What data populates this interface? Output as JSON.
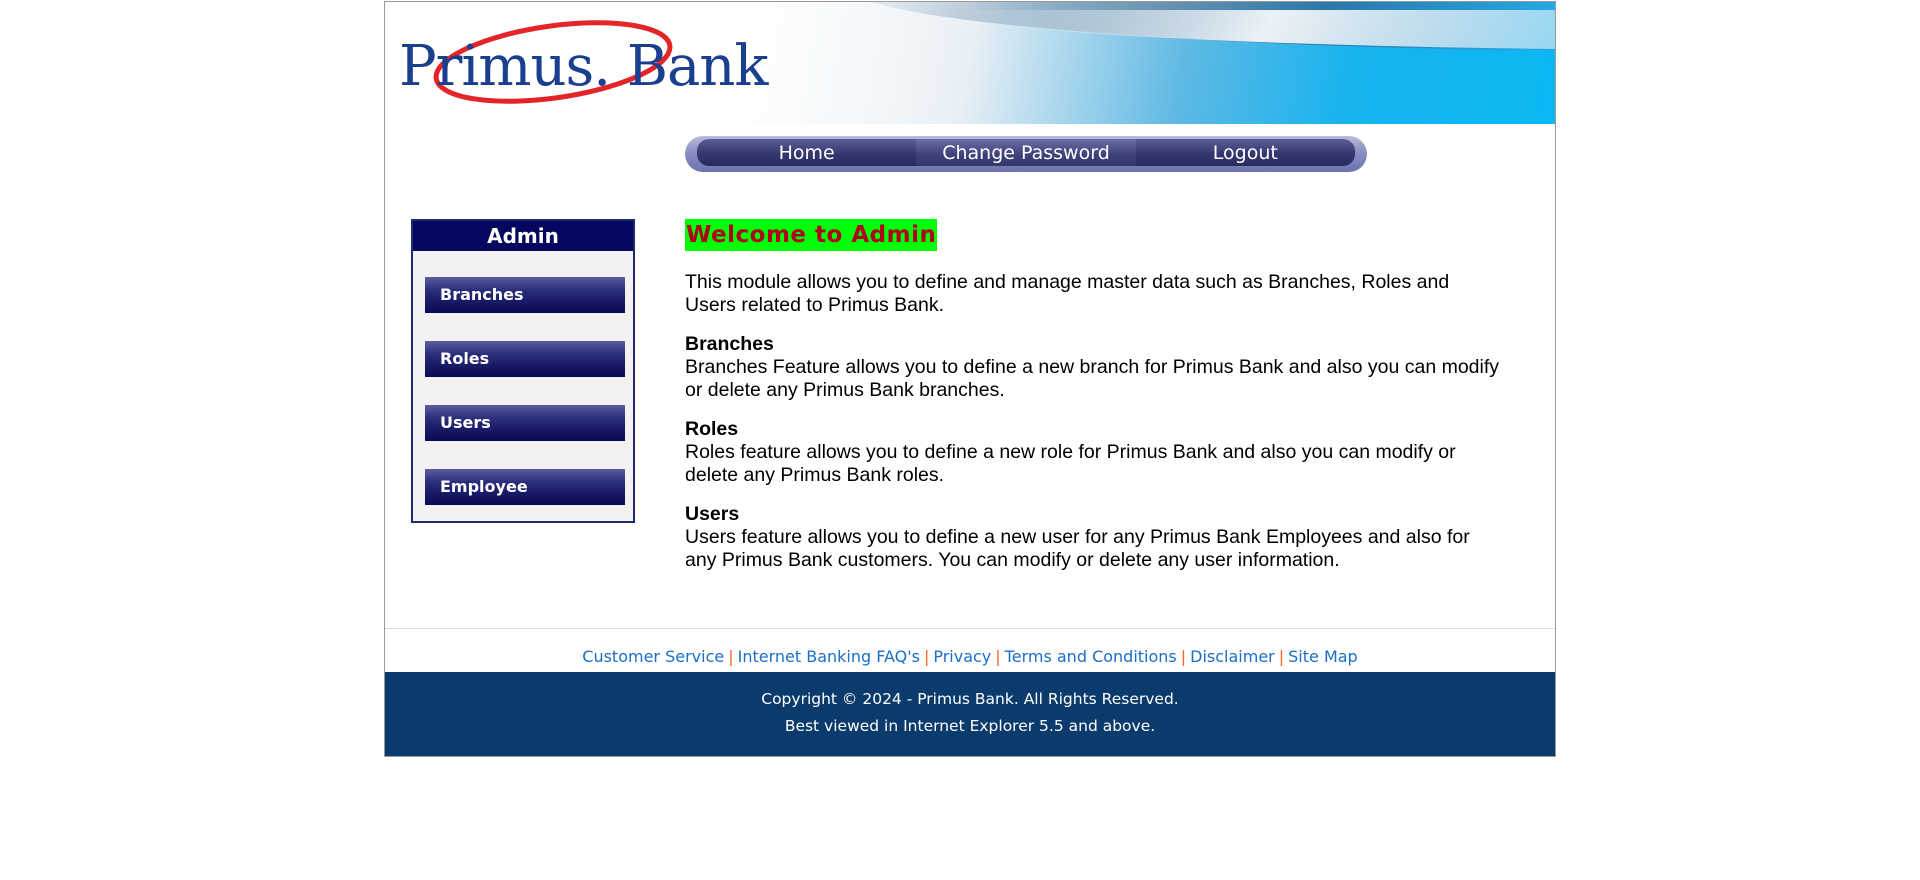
{
  "brand": {
    "logo_text": "Primus. Bank"
  },
  "nav": {
    "items": [
      "Home",
      "Change Password",
      "Logout"
    ]
  },
  "sidebar": {
    "title": "Admin",
    "items": [
      "Branches",
      "Roles",
      "Users",
      "Employee"
    ]
  },
  "main": {
    "welcome": "Welcome to Admin",
    "intro": "This module allows you to define and manage master data such as Branches, Roles and Users related to Primus Bank.",
    "sections": [
      {
        "title": "Branches",
        "text": "Branches Feature allows you to define a new branch for Primus Bank and also you can modify or delete any Primus Bank branches."
      },
      {
        "title": "Roles",
        "text": "Roles feature allows you to define a new role for Primus Bank and also you can modify or delete any Primus Bank roles."
      },
      {
        "title": "Users",
        "text": "Users feature allows you to define a new user for any Primus Bank Employees and also for any Primus Bank customers. You can modify or delete any user information."
      }
    ]
  },
  "footer": {
    "links": [
      "Customer Service",
      "Internet Banking FAQ's",
      "Privacy",
      "Terms and Conditions",
      "Disclaimer",
      "Site Map"
    ],
    "separator": "|",
    "copyright": "Copyright © 2024 - Primus Bank. All Rights Reserved.",
    "browser_note": "Best viewed in Internet Explorer 5.5 and above."
  },
  "colors": {
    "footer_bg": "#0b3a6d",
    "sidebar_title_bg": "#05065e",
    "welcome_bg": "#00ff0a",
    "welcome_text": "#b0001a",
    "link": "#1a6fc9",
    "separator": "#f26522"
  }
}
